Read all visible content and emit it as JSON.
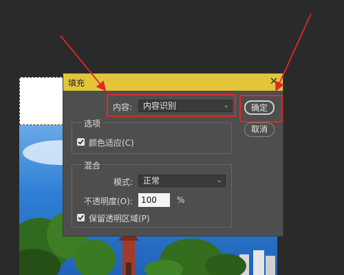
{
  "dialog": {
    "title": "填充",
    "content_label": "内容:",
    "content_value": "内容识别",
    "options_group": "选项",
    "color_adapt_label": "颜色适应(C)",
    "blend_group": "混合",
    "mode_label": "模式:",
    "mode_value": "正常",
    "opacity_label": "不透明度(O):",
    "opacity_value": "100",
    "opacity_unit": "%",
    "preserve_label": "保留透明区域(P)",
    "ok_label": "确定",
    "cancel_label": "取消"
  },
  "colors": {
    "titlebar": "#e3c53a",
    "annotation": "#e02828",
    "dialog_bg": "#4e4e4e"
  }
}
